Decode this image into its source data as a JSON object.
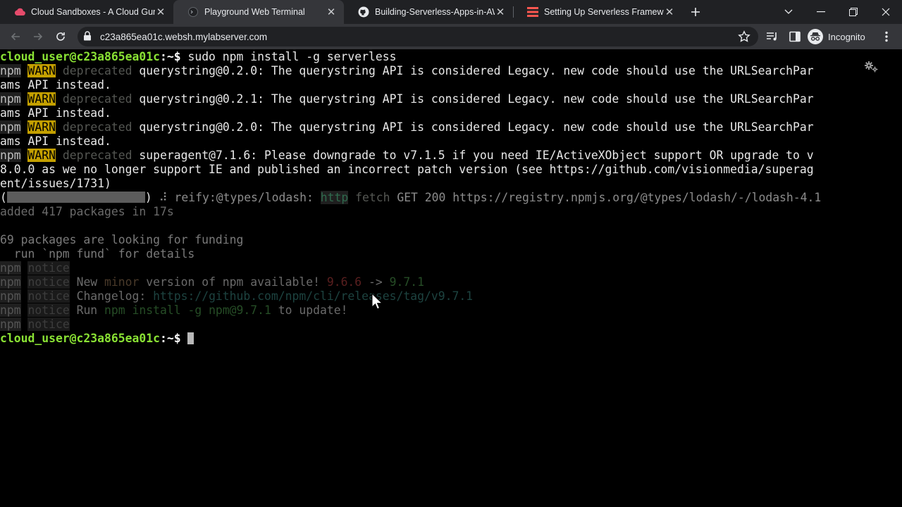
{
  "tabs": [
    {
      "title": "Cloud Sandboxes - A Cloud Guru",
      "favicon": "cloud-icon",
      "active": false
    },
    {
      "title": "Playground Web Terminal",
      "favicon": "terminal-icon",
      "active": true
    },
    {
      "title": "Building-Serverless-Apps-in-AWS",
      "favicon": "github-icon",
      "active": false
    },
    {
      "title": "Setting Up Serverless Framework",
      "favicon": "serverless-icon",
      "active": false
    }
  ],
  "toolbar": {
    "url": "c23a865ea01c.websh.mylabserver.com",
    "incognito_label": "Incognito"
  },
  "colors": {
    "prompt": "#8ae234",
    "warn_bg": "#c4a000",
    "chrome_dark": "#202124",
    "chrome_toolbar": "#35363a"
  },
  "terminal": {
    "prompt": "cloud_user@c23a865ea01c",
    "prompt_path": ":~$ ",
    "command": "sudo npm install -g serverless",
    "npm_tag": "npm",
    "warn_tag": "WARN",
    "deprecated_tag": "deprecated",
    "notice_tag": "notice",
    "warnings": {
      "w1a": " querystring@0.2.0: The querystring API is considered Legacy. new code should use the URLSearchPar",
      "w1b": "ams API instead.",
      "w2a": " querystring@0.2.1: The querystring API is considered Legacy. new code should use the URLSearchPar",
      "w2b": "ams API instead.",
      "w3a": " querystring@0.2.0: The querystring API is considered Legacy. new code should use the URLSearchPar",
      "w3b": "ams API instead.",
      "w4a": " superagent@7.1.6: Please downgrade to v7.1.5 if you need IE/ActiveXObject support OR upgrade to v",
      "w4b": "8.0.0 as we no longer support IE and published an incorrect patch version (see https://github.com/visionmedia/superag",
      "w4c": "ent/issues/1731)"
    },
    "progress": {
      "open": "(",
      "close": ") ",
      "spinner": "⠼",
      "label": " reify:@types/lodash: ",
      "http": "http",
      "fetch": "fetch",
      "rest": " GET 200 https://registry.npmjs.org/@types/lodash/-/lodash-4.1"
    },
    "added": "added 417 packages in 17s",
    "funding1": "69 packages are looking for funding",
    "funding2": "  run `npm fund` for details",
    "update": {
      "new_a": " New ",
      "minor": "minor",
      "new_b": " version of npm available! ",
      "old_version": "9.6.6",
      "arrow": " -> ",
      "new_version": "9.7.1",
      "changelog_label": " Changelog: ",
      "changelog_url": "https://github.com/npm/cli/releases/tag/v9.7.1",
      "run_label": " Run ",
      "run_cmd": "npm install -g npm@9.7.1",
      "run_tail": " to update!"
    }
  }
}
